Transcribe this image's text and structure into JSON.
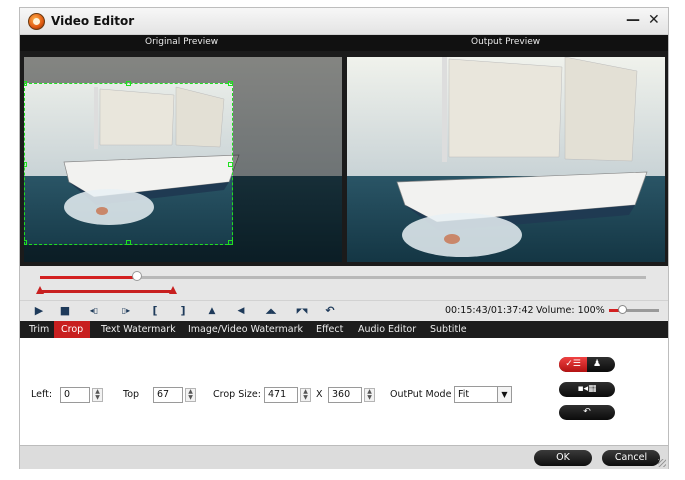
{
  "window": {
    "title": "Video Editor",
    "minimize_glyph": "—",
    "close_glyph": "✕"
  },
  "preview": {
    "original_label": "Original Preview",
    "output_label": "Output Preview"
  },
  "seek": {
    "position_fraction": 0.16,
    "range_start_fraction": 0.0,
    "range_end_fraction": 0.22
  },
  "controls": {
    "icons": [
      "play-icon",
      "stop-icon",
      "prev-frame-icon",
      "next-frame-icon",
      "mark-in-icon",
      "mark-out-icon",
      "flip-vertical-icon",
      "rotate-left-icon",
      "flip-horizontal-icon",
      "rotate-right-icon",
      "undo-icon"
    ],
    "glyphs": [
      "▶",
      "■",
      "◂▯",
      "▯▸",
      "[",
      "]",
      "▲",
      "◀",
      "◢◣",
      "◤◥",
      "↶"
    ],
    "timecode": "00:15:43/01:37:42",
    "volume_label": "Volume:",
    "volume_value": "100%",
    "volume_fraction": 0.25
  },
  "tabs": [
    {
      "label": "Trim",
      "active": false
    },
    {
      "label": "Crop",
      "active": true
    },
    {
      "label": "Text Watermark",
      "active": false
    },
    {
      "label": "Image/Video Watermark",
      "active": false
    },
    {
      "label": "Effect",
      "active": false
    },
    {
      "label": "Audio Editor",
      "active": false
    },
    {
      "label": "Subtitle",
      "active": false
    }
  ],
  "crop": {
    "left_label": "Left:",
    "left_value": "0",
    "top_label": "Top",
    "top_value": "67",
    "size_label": "Crop Size:",
    "width_value": "471",
    "x_label": "X",
    "height_value": "360",
    "output_mode_label": "OutPut Mode",
    "output_mode_value": "Fit"
  },
  "side_buttons": {
    "top_left_icon": "checklist-icon",
    "top_right_icon": "person-icon",
    "middle_icon": "grid-expand-icon",
    "bottom_icon": "reset-icon"
  },
  "footer": {
    "ok_label": "OK",
    "cancel_label": "Cancel"
  },
  "colors": {
    "accent_red": "#c81f1f",
    "crop_green": "#1fe01f",
    "dark_bar": "#1d1d1d"
  }
}
